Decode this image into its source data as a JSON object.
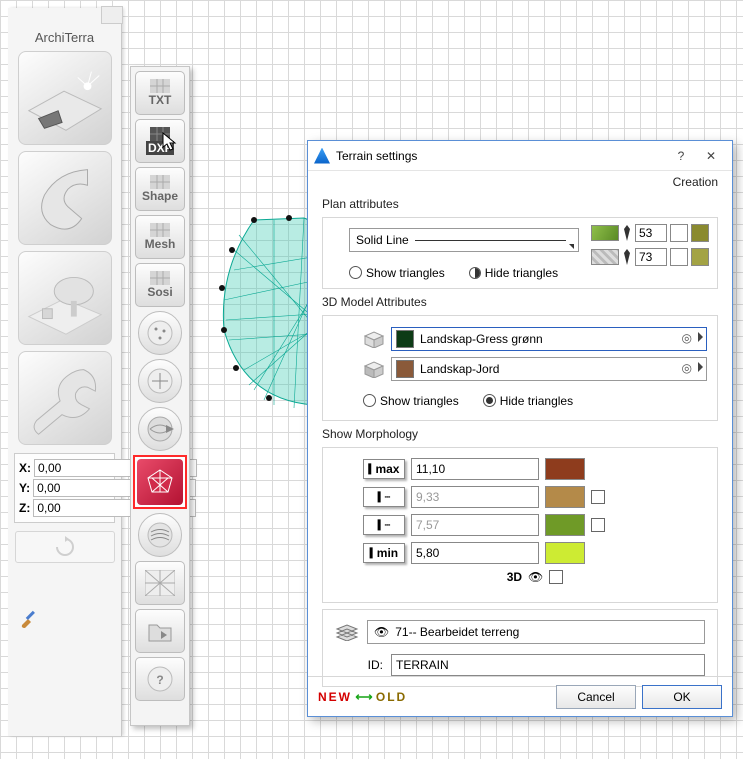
{
  "palette": {
    "title": "ArchiTerra",
    "coords": {
      "x_label": "X:",
      "x_value": "0,00",
      "y_label": "Y:",
      "y_value": "0,00",
      "z_label": "Z:",
      "z_value": "0,00"
    }
  },
  "toolbar2": {
    "items": [
      "TXT",
      "DXF",
      "Shape",
      "Mesh",
      "Sosi"
    ]
  },
  "dialog": {
    "title": "Terrain settings",
    "subtitle": "Creation",
    "plan": {
      "heading": "Plan attributes",
      "line_type": "Solid Line",
      "pen1": "53",
      "pen2": "73",
      "show_tri": "Show triangles",
      "hide_tri": "Hide triangles"
    },
    "model": {
      "heading": "3D Model Attributes",
      "mat1": "Landskap-Gress grønn",
      "mat2": "Landskap-Jord",
      "show_tri": "Show triangles",
      "hide_tri": "Hide triangles"
    },
    "morph": {
      "heading": "Show Morphology",
      "max_lbl": "max",
      "max_val": "11,10",
      "v2": "9,33",
      "v3": "7,57",
      "min_lbl": "min",
      "min_val": "5,80",
      "view3d": "3D"
    },
    "layer": {
      "value": "71-- Bearbeidet terreng",
      "id_label": "ID:",
      "id_value": "TERRAIN"
    },
    "footer": {
      "new": "NEW",
      "old": "OLD",
      "cancel": "Cancel",
      "ok": "OK"
    }
  },
  "chart_data": {
    "type": "table",
    "title": "Terrain morphology color ramp",
    "rows": [
      {
        "label": "max",
        "value": 11.1,
        "color": "#8e3c1d"
      },
      {
        "label": "",
        "value": 9.33,
        "color": "#b48a49"
      },
      {
        "label": "",
        "value": 7.57,
        "color": "#6f9a27"
      },
      {
        "label": "min",
        "value": 5.8,
        "color": "#cdeb33"
      }
    ]
  }
}
